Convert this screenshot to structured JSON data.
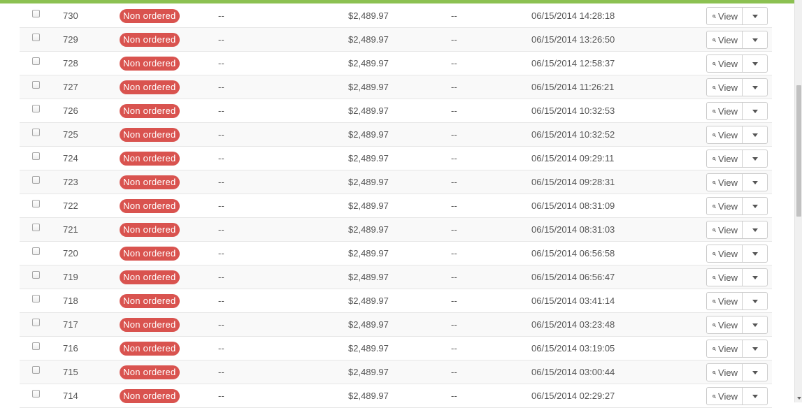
{
  "colors": {
    "top_bar": "#8cc152",
    "badge": "#d9534f"
  },
  "actions": {
    "view_label": "View",
    "view_icon": "zoom-in-icon",
    "menu_icon": "caret-down-icon"
  },
  "rows": [
    {
      "id": "730",
      "status": "Non ordered",
      "col3": "--",
      "amount": "$2,489.97",
      "col5": "--",
      "date": "06/15/2014 14:28:18"
    },
    {
      "id": "729",
      "status": "Non ordered",
      "col3": "--",
      "amount": "$2,489.97",
      "col5": "--",
      "date": "06/15/2014 13:26:50"
    },
    {
      "id": "728",
      "status": "Non ordered",
      "col3": "--",
      "amount": "$2,489.97",
      "col5": "--",
      "date": "06/15/2014 12:58:37"
    },
    {
      "id": "727",
      "status": "Non ordered",
      "col3": "--",
      "amount": "$2,489.97",
      "col5": "--",
      "date": "06/15/2014 11:26:21"
    },
    {
      "id": "726",
      "status": "Non ordered",
      "col3": "--",
      "amount": "$2,489.97",
      "col5": "--",
      "date": "06/15/2014 10:32:53"
    },
    {
      "id": "725",
      "status": "Non ordered",
      "col3": "--",
      "amount": "$2,489.97",
      "col5": "--",
      "date": "06/15/2014 10:32:52"
    },
    {
      "id": "724",
      "status": "Non ordered",
      "col3": "--",
      "amount": "$2,489.97",
      "col5": "--",
      "date": "06/15/2014 09:29:11"
    },
    {
      "id": "723",
      "status": "Non ordered",
      "col3": "--",
      "amount": "$2,489.97",
      "col5": "--",
      "date": "06/15/2014 09:28:31"
    },
    {
      "id": "722",
      "status": "Non ordered",
      "col3": "--",
      "amount": "$2,489.97",
      "col5": "--",
      "date": "06/15/2014 08:31:09"
    },
    {
      "id": "721",
      "status": "Non ordered",
      "col3": "--",
      "amount": "$2,489.97",
      "col5": "--",
      "date": "06/15/2014 08:31:03"
    },
    {
      "id": "720",
      "status": "Non ordered",
      "col3": "--",
      "amount": "$2,489.97",
      "col5": "--",
      "date": "06/15/2014 06:56:58"
    },
    {
      "id": "719",
      "status": "Non ordered",
      "col3": "--",
      "amount": "$2,489.97",
      "col5": "--",
      "date": "06/15/2014 06:56:47"
    },
    {
      "id": "718",
      "status": "Non ordered",
      "col3": "--",
      "amount": "$2,489.97",
      "col5": "--",
      "date": "06/15/2014 03:41:14"
    },
    {
      "id": "717",
      "status": "Non ordered",
      "col3": "--",
      "amount": "$2,489.97",
      "col5": "--",
      "date": "06/15/2014 03:23:48"
    },
    {
      "id": "716",
      "status": "Non ordered",
      "col3": "--",
      "amount": "$2,489.97",
      "col5": "--",
      "date": "06/15/2014 03:19:05"
    },
    {
      "id": "715",
      "status": "Non ordered",
      "col3": "--",
      "amount": "$2,489.97",
      "col5": "--",
      "date": "06/15/2014 03:00:44"
    },
    {
      "id": "714",
      "status": "Non ordered",
      "col3": "--",
      "amount": "$2,489.97",
      "col5": "--",
      "date": "06/15/2014 02:29:27"
    }
  ]
}
